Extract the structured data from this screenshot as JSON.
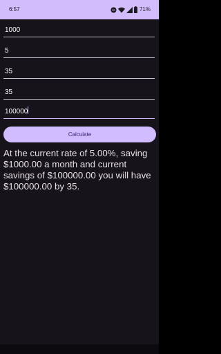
{
  "status_bar": {
    "time": "6:57",
    "battery_percent": "71%",
    "icons": [
      "do-not-disturb-icon",
      "wifi-icon",
      "signal-icon",
      "battery-icon"
    ]
  },
  "form": {
    "fields": [
      {
        "name": "monthly-savings-field",
        "value": "1000"
      },
      {
        "name": "interest-rate-field",
        "value": "5"
      },
      {
        "name": "current-age-field",
        "value": "35"
      },
      {
        "name": "target-age-field",
        "value": "35"
      },
      {
        "name": "current-savings-field",
        "value": "100000"
      }
    ],
    "calculate_label": "Calculate"
  },
  "result": {
    "text": "At the current rate of 5.00%, saving $1000.00 a month and current savings of $100000.00 you will have $100000.00 by 35."
  },
  "colors": {
    "status_bar_bg": "#d2bcfb",
    "background": "#16131a",
    "accent": "#d0bcff",
    "button_text": "#381e72",
    "text": "#e6e1e5"
  }
}
